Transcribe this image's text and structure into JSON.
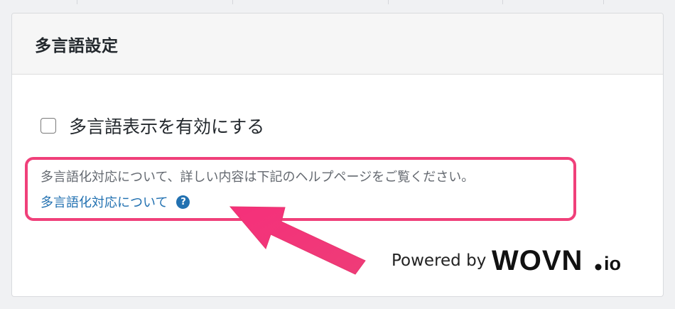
{
  "panel": {
    "title": "多言語設定",
    "checkbox_label": "多言語表示を有効にする",
    "checkbox_checked": false,
    "help_text": "多言語化対応について、詳しい内容は下記のヘルプページをご覧ください。",
    "help_link": "多言語化対応について",
    "help_icon": "?"
  },
  "footer": {
    "powered_by": "Powered by",
    "logo_text": "WOVN.io"
  },
  "colors": {
    "highlight": "#f0407a",
    "link": "#2271b1"
  }
}
